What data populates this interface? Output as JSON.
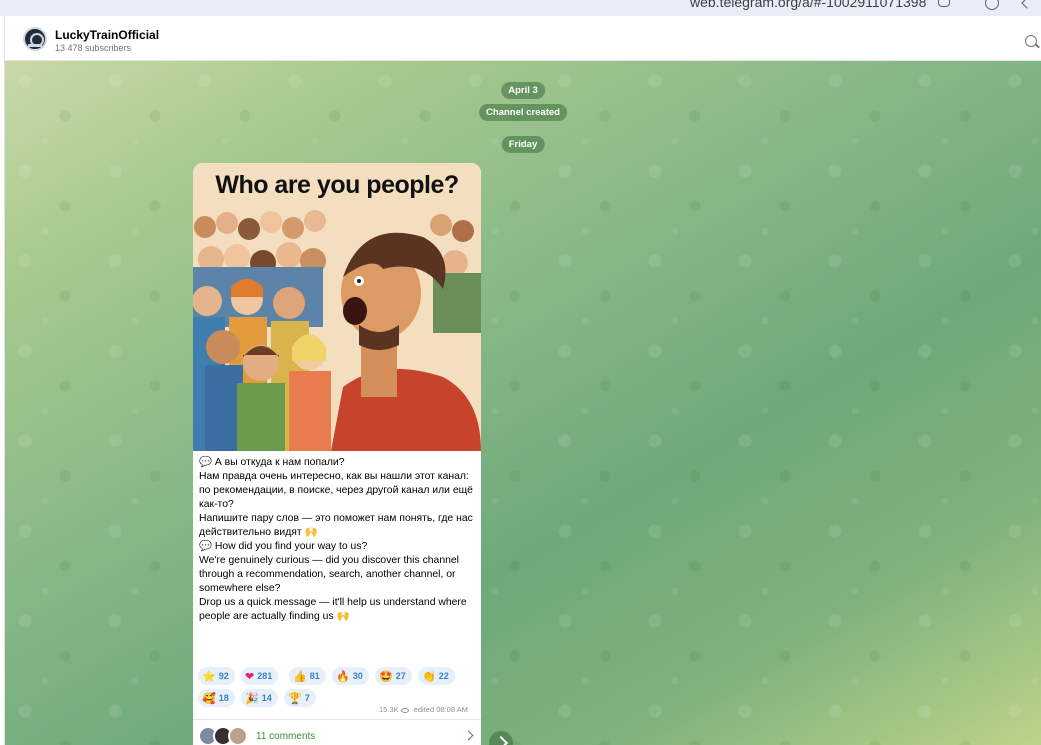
{
  "browser": {
    "url": "web.telegram.org/a/#-1002911071398"
  },
  "channel": {
    "title": "LuckyTrainOfficial",
    "subscribers": "13 478 subscribers"
  },
  "chat": {
    "service": [
      "April 3",
      "Channel created",
      "Friday"
    ]
  },
  "post": {
    "image": {
      "title": "Who are you people?"
    },
    "text": [
      "💬 А вы откуда к нам попали?",
      "Нам правда очень интересно, как вы нашли этот канал: по рекомендации, в поиске, через другой канал или ещё как-то?",
      "",
      "Напишите пару слов — это поможет нам понять, где нас действительно видят 🙌",
      "",
      "💬 How did you find your way to us?",
      "We're genuinely curious — did you discover this channel through a recommendation, search, another channel, or somewhere else?",
      "",
      "Drop us a quick message — it'll help us understand where people are actually finding us 🙌"
    ],
    "reactions": [
      {
        "emoji": "⭐",
        "count": "92"
      },
      {
        "emoji": "❤",
        "count": "281"
      },
      {
        "emoji": "👍",
        "count": "81"
      },
      {
        "emoji": "🔥",
        "count": "30"
      },
      {
        "emoji": "🤩",
        "count": "27"
      },
      {
        "emoji": "👏",
        "count": "22"
      },
      {
        "emoji": "🥰",
        "count": "18"
      },
      {
        "emoji": "🎉",
        "count": "14"
      },
      {
        "emoji": "🏆",
        "count": "7"
      }
    ],
    "views": "15.3K",
    "edited": "edited 08:08 AM",
    "comments": "11 comments"
  },
  "colors": {
    "accent": "#3d7fc9",
    "comments_green": "#3d8b3d"
  }
}
